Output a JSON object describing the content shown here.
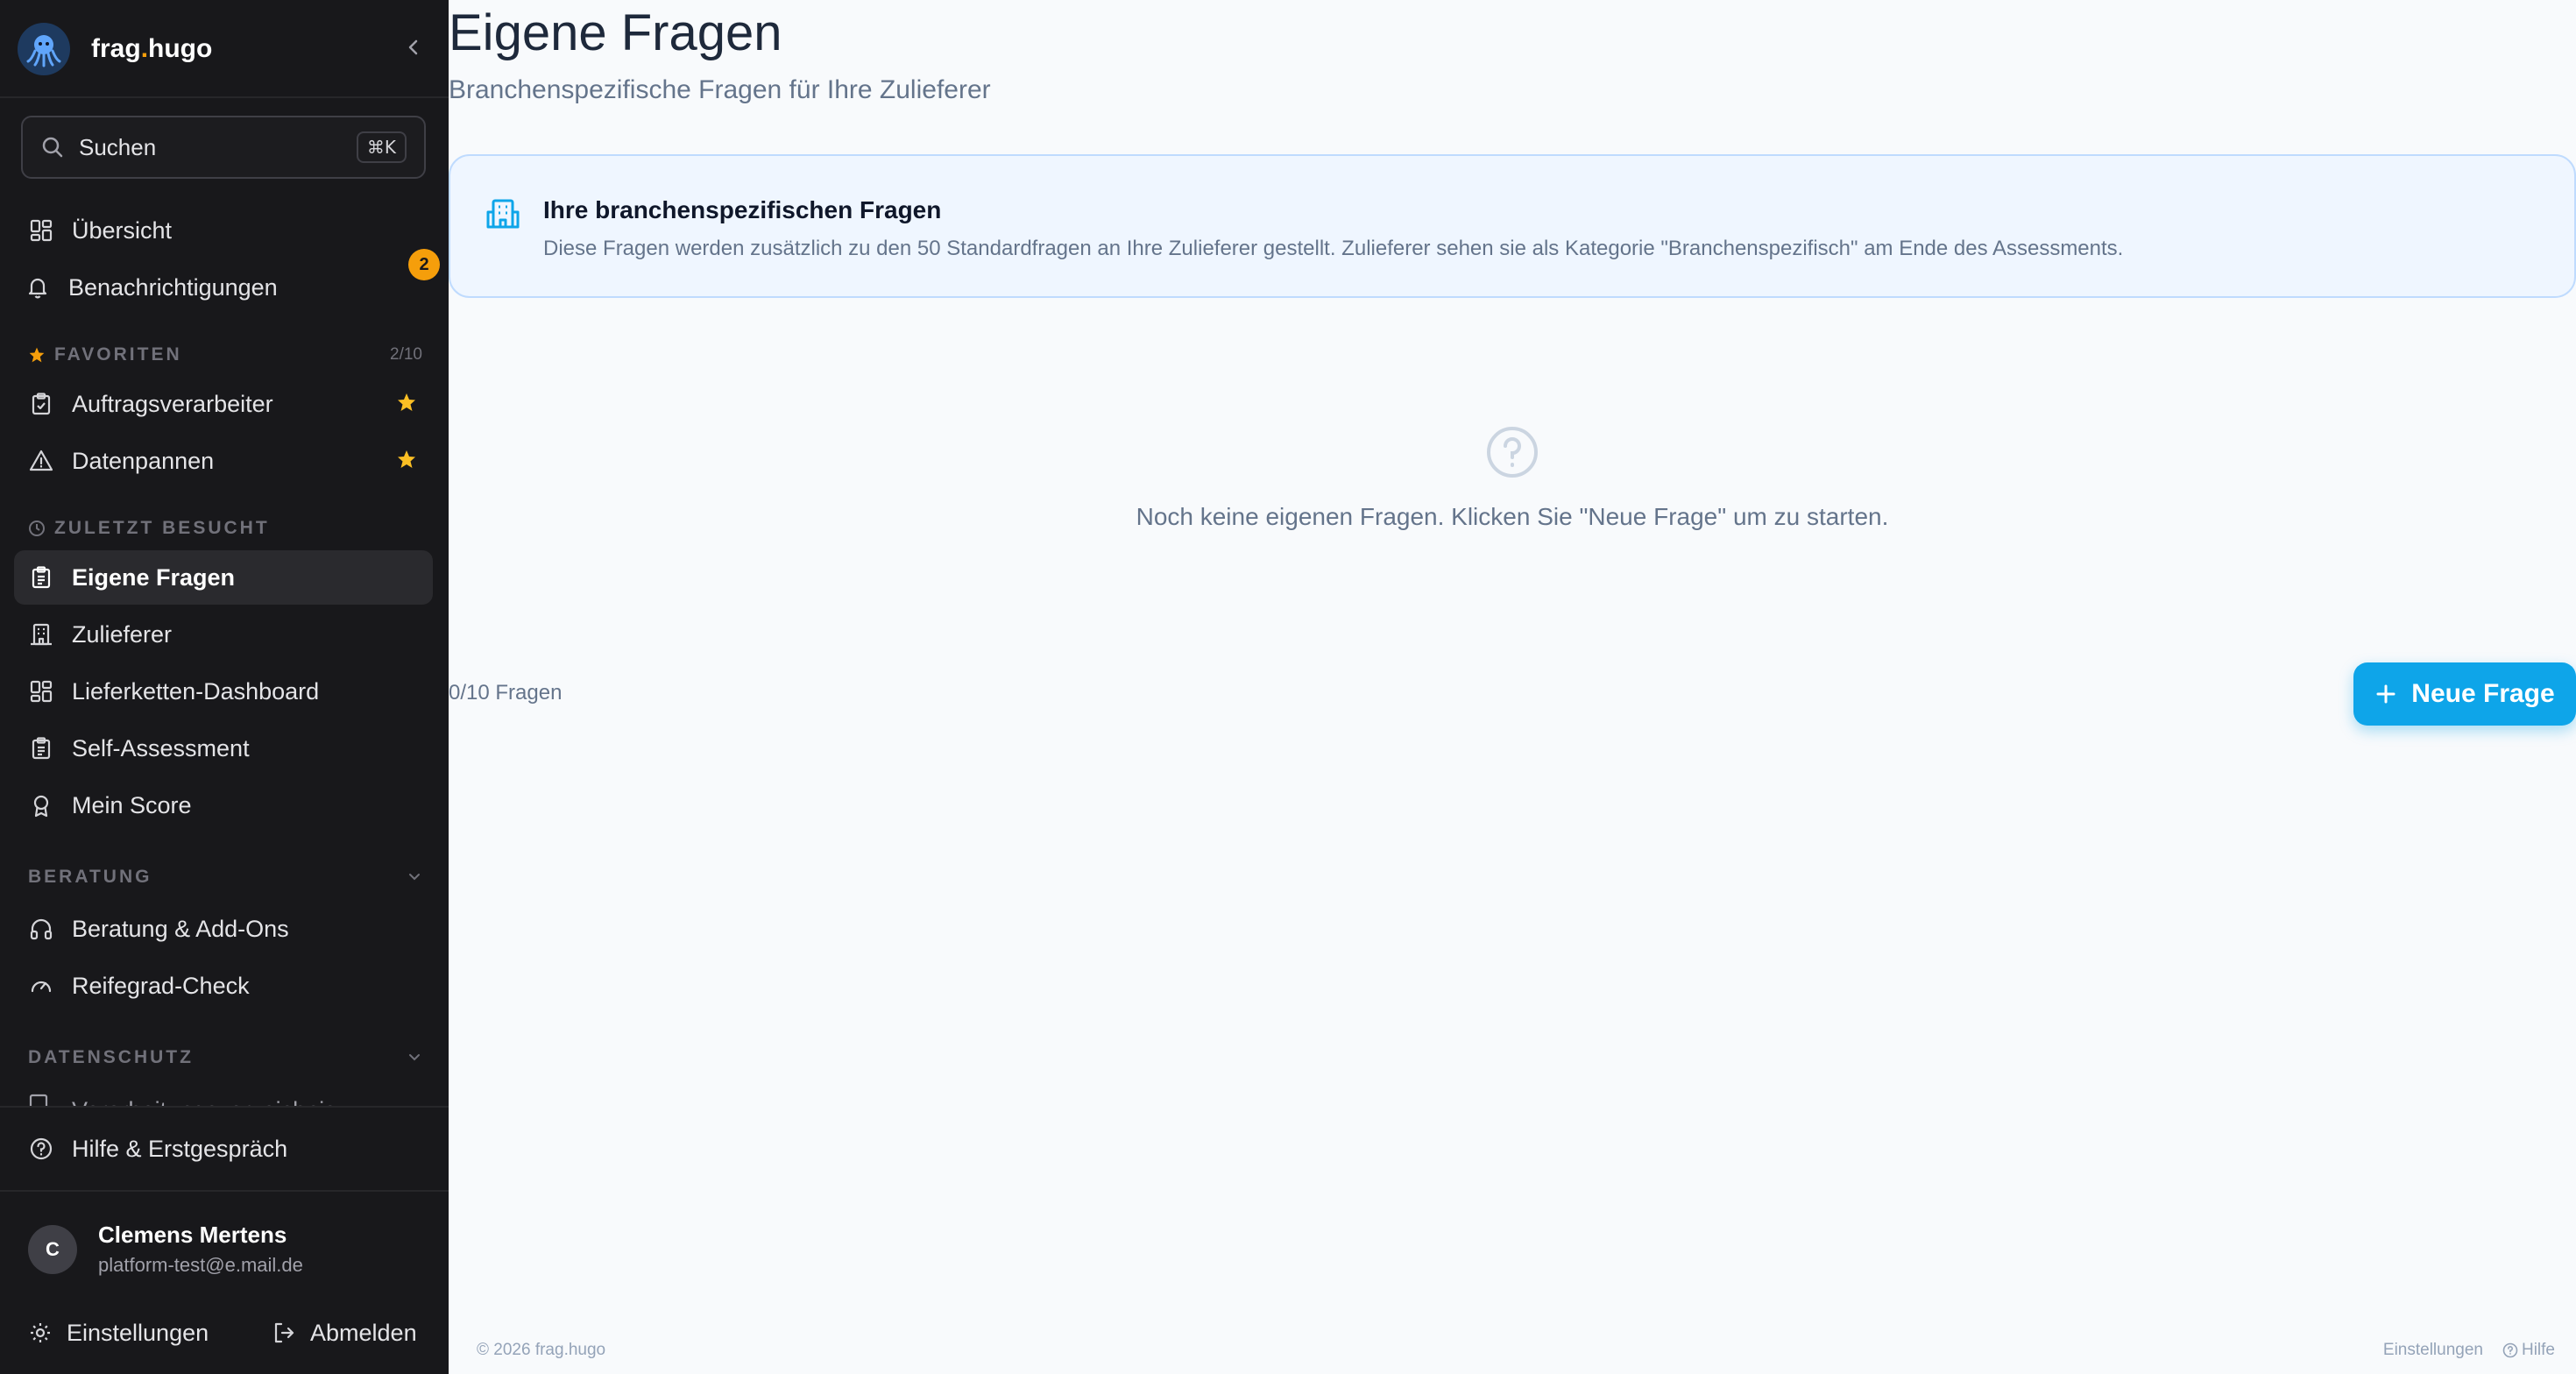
{
  "brand": {
    "name_main": "frag",
    "name_dot": ".",
    "name_end": "hugo"
  },
  "search": {
    "label": "Suchen",
    "shortcut": "⌘K"
  },
  "nav_top": [
    {
      "label": "Übersicht",
      "icon": "dashboard-icon"
    },
    {
      "label": "Benachrichtigungen",
      "icon": "bell-icon",
      "badge": "2"
    }
  ],
  "favorites": {
    "title": "FAVORITEN",
    "count": "2/10",
    "items": [
      {
        "label": "Auftragsverarbeiter",
        "icon": "clipboard-check-icon"
      },
      {
        "label": "Datenpannen",
        "icon": "warning-icon"
      }
    ]
  },
  "recent": {
    "title": "ZULETZT BESUCHT",
    "items": [
      {
        "label": "Eigene Fragen",
        "icon": "clipboard-list-icon",
        "active": true
      },
      {
        "label": "Zulieferer",
        "icon": "building-icon"
      },
      {
        "label": "Lieferketten-Dashboard",
        "icon": "dashboard-icon"
      },
      {
        "label": "Self-Assessment",
        "icon": "clipboard-list-icon"
      },
      {
        "label": "Mein Score",
        "icon": "award-icon"
      }
    ]
  },
  "beratung": {
    "title": "BERATUNG",
    "items": [
      {
        "label": "Beratung & Add-Ons",
        "icon": "headphones-icon"
      },
      {
        "label": "Reifegrad-Check",
        "icon": "gauge-icon"
      }
    ]
  },
  "datenschutz": {
    "title": "DATENSCHUTZ",
    "partial_item": "Verarbeitungsverzeichnis"
  },
  "help": {
    "label": "Hilfe & Erstgespräch"
  },
  "user": {
    "initial": "C",
    "name": "Clemens Mertens",
    "email": "platform-test@e.mail.de"
  },
  "bottom": {
    "settings": "Einstellungen",
    "logout": "Abmelden"
  },
  "main": {
    "title": "Eigene Fragen",
    "subtitle": "Branchenspezifische Fragen für Ihre Zulieferer",
    "info_title": "Ihre branchenspezifischen Fragen",
    "info_text": "Diese Fragen werden zusätzlich zu den 50 Standardfragen an Ihre Zulieferer gestellt. Zulieferer sehen sie als Kategorie \"Branchenspezifisch\" am Ende des Assessments.",
    "empty_text": "Noch keine eigenen Fragen. Klicken Sie \"Neue Frage\" um zu starten.",
    "count": "0/10 Fragen",
    "new_button": "Neue Frage"
  },
  "footer": {
    "copyright": "© 2026 frag.hugo",
    "settings": "Einstellungen",
    "help": "Hilfe"
  },
  "colors": {
    "accent": "#0ea5e9",
    "badge": "#f59e0b",
    "sidebar_bg": "#18181b",
    "info_bg": "#eff6ff"
  }
}
